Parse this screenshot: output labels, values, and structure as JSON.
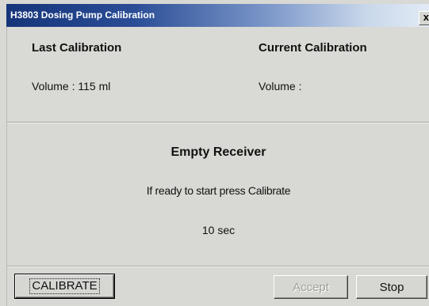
{
  "window": {
    "title": "H3803 Dosing Pump Calibration",
    "close_glyph": "x"
  },
  "last_calibration": {
    "heading": "Last Calibration",
    "volume": "Volume : 115 ml"
  },
  "current_calibration": {
    "heading": "Current Calibration",
    "volume": "Volume :"
  },
  "status": {
    "heading": "Empty Receiver",
    "instruction": "If ready to start press Calibrate",
    "timer": "10 sec"
  },
  "buttons": {
    "calibrate": "CALIBRATE",
    "accept": "Accept",
    "stop": "Stop"
  },
  "colors": {
    "titlebar_start": "#16357a",
    "titlebar_end": "#e2ebf5",
    "window_face": "#d8d8d4",
    "disabled_text": "#a0a09c"
  },
  "icons": {
    "close": "close-icon"
  }
}
